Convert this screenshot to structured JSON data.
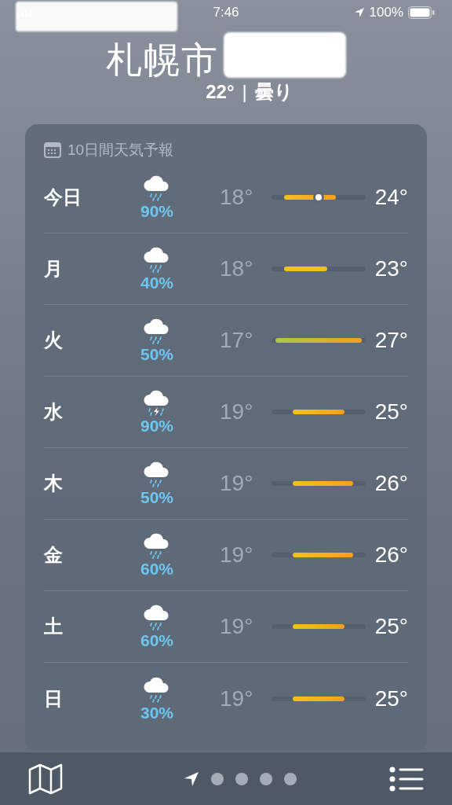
{
  "status_bar": {
    "time": "7:46",
    "battery": "100%"
  },
  "header": {
    "city": "札幌市",
    "current": "22°",
    "separator": "|",
    "condition": "曇り"
  },
  "forecast": {
    "title": "10日間天気予報",
    "days": [
      {
        "day": "今日",
        "kind": "rain",
        "precip": "90%",
        "low": "18°",
        "high": "24°",
        "current_marker": true
      },
      {
        "day": "月",
        "kind": "rain",
        "precip": "40%",
        "low": "18°",
        "high": "23°",
        "current_marker": false
      },
      {
        "day": "火",
        "kind": "rain",
        "precip": "50%",
        "low": "17°",
        "high": "27°",
        "current_marker": false
      },
      {
        "day": "水",
        "kind": "thunder",
        "precip": "90%",
        "low": "19°",
        "high": "25°",
        "current_marker": false
      },
      {
        "day": "木",
        "kind": "rain",
        "precip": "50%",
        "low": "19°",
        "high": "26°",
        "current_marker": false
      },
      {
        "day": "金",
        "kind": "rain",
        "precip": "60%",
        "low": "19°",
        "high": "26°",
        "current_marker": false
      },
      {
        "day": "土",
        "kind": "rain",
        "precip": "60%",
        "low": "19°",
        "high": "25°",
        "current_marker": false
      },
      {
        "day": "日",
        "kind": "rain",
        "precip": "30%",
        "low": "19°",
        "high": "25°",
        "current_marker": false
      }
    ]
  },
  "pages": [
    {
      "kind": "location",
      "selected": true
    },
    {
      "kind": "dot",
      "selected": false
    },
    {
      "kind": "dot",
      "selected": false
    },
    {
      "kind": "dot",
      "selected": false
    },
    {
      "kind": "dot",
      "selected": false
    }
  ]
}
